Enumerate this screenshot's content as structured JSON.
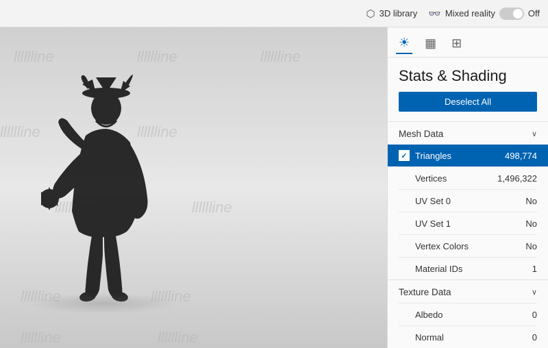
{
  "topbar": {
    "library_label": "3D library",
    "mixed_reality_label": "Mixed reality",
    "off_label": "Off"
  },
  "viewport": {
    "watermarks": [
      "lllllline",
      "lllllline",
      "lllllline",
      "lllllline",
      "lllllline",
      "lllllline",
      "lllllline",
      "lllllline",
      "lllllline",
      "lllllline",
      "lllllline"
    ]
  },
  "panel": {
    "title": "Stats & Shading",
    "deselect_button": "Deselect All",
    "sections": [
      {
        "name": "Mesh Data",
        "rows": [
          {
            "label": "Triangles",
            "value": "498,774",
            "checked": true,
            "highlighted": true
          },
          {
            "label": "Vertices",
            "value": "1,496,322",
            "checked": false,
            "highlighted": false
          },
          {
            "label": "UV Set 0",
            "value": "No",
            "checked": false,
            "highlighted": false
          },
          {
            "label": "UV Set 1",
            "value": "No",
            "checked": false,
            "highlighted": false
          },
          {
            "label": "Vertex Colors",
            "value": "No",
            "checked": false,
            "highlighted": false
          },
          {
            "label": "Material IDs",
            "value": "1",
            "checked": false,
            "highlighted": false
          }
        ]
      },
      {
        "name": "Texture Data",
        "rows": [
          {
            "label": "Albedo",
            "value": "0",
            "checked": false,
            "highlighted": false
          },
          {
            "label": "Normal",
            "value": "0",
            "checked": false,
            "highlighted": false
          }
        ]
      }
    ]
  }
}
